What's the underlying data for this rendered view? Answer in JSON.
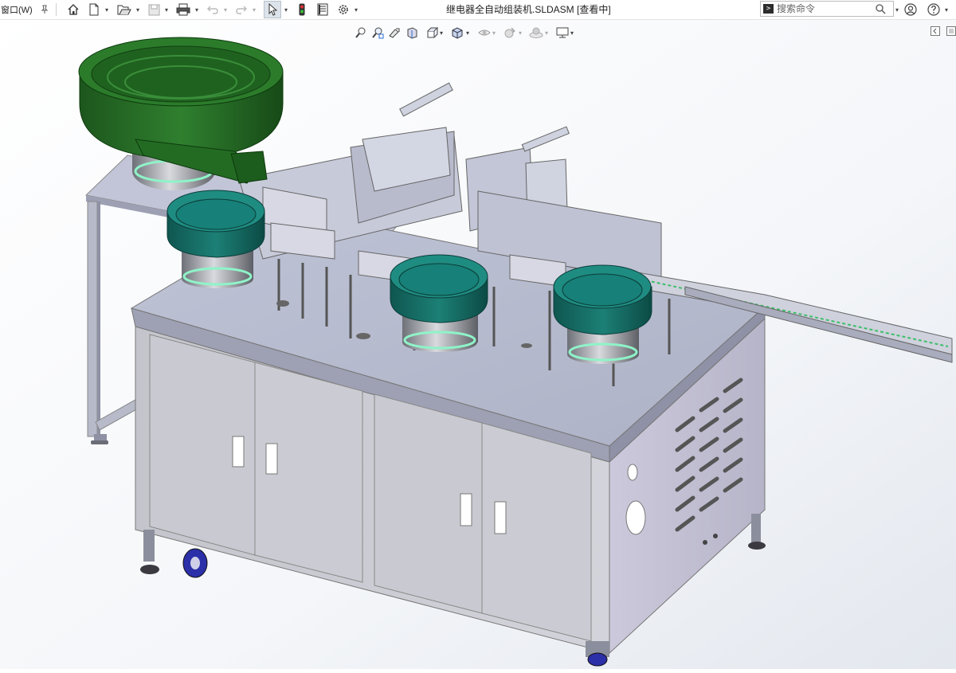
{
  "menu": {
    "window_label": "窗口(W)"
  },
  "document": {
    "title": "继电器全自动组装机.SLDASM [查看中]"
  },
  "search": {
    "placeholder": "搜索命令"
  },
  "toolbar_icons": [
    "pin-icon",
    "home-icon",
    "new-document-icon",
    "open-document-icon",
    "save-icon",
    "print-icon",
    "undo-icon",
    "redo-icon",
    "select-pointer-icon",
    "rebuild-traffic-light-icon",
    "file-properties-icon",
    "options-gear-icon"
  ],
  "heads_up_icons": [
    "zoom-to-fit-icon",
    "zoom-to-area-icon",
    "previous-view-icon",
    "section-view-icon",
    "view-orientation-icon",
    "display-style-icon",
    "hide-show-items-icon",
    "edit-appearance-icon",
    "apply-scene-icon",
    "view-settings-icon"
  ],
  "colors": {
    "frame_steel": "#b9bccb",
    "cabinet_light": "#c9cad3",
    "feeder_green_dark": "#1f5a1f",
    "feeder_green": "#2e7d2e",
    "bowl_teal": "#1e8a80",
    "bowl_teal_dark": "#0f5a55",
    "rim_glow": "#8ff3c8",
    "caster_blue": "#2b2fa8"
  }
}
